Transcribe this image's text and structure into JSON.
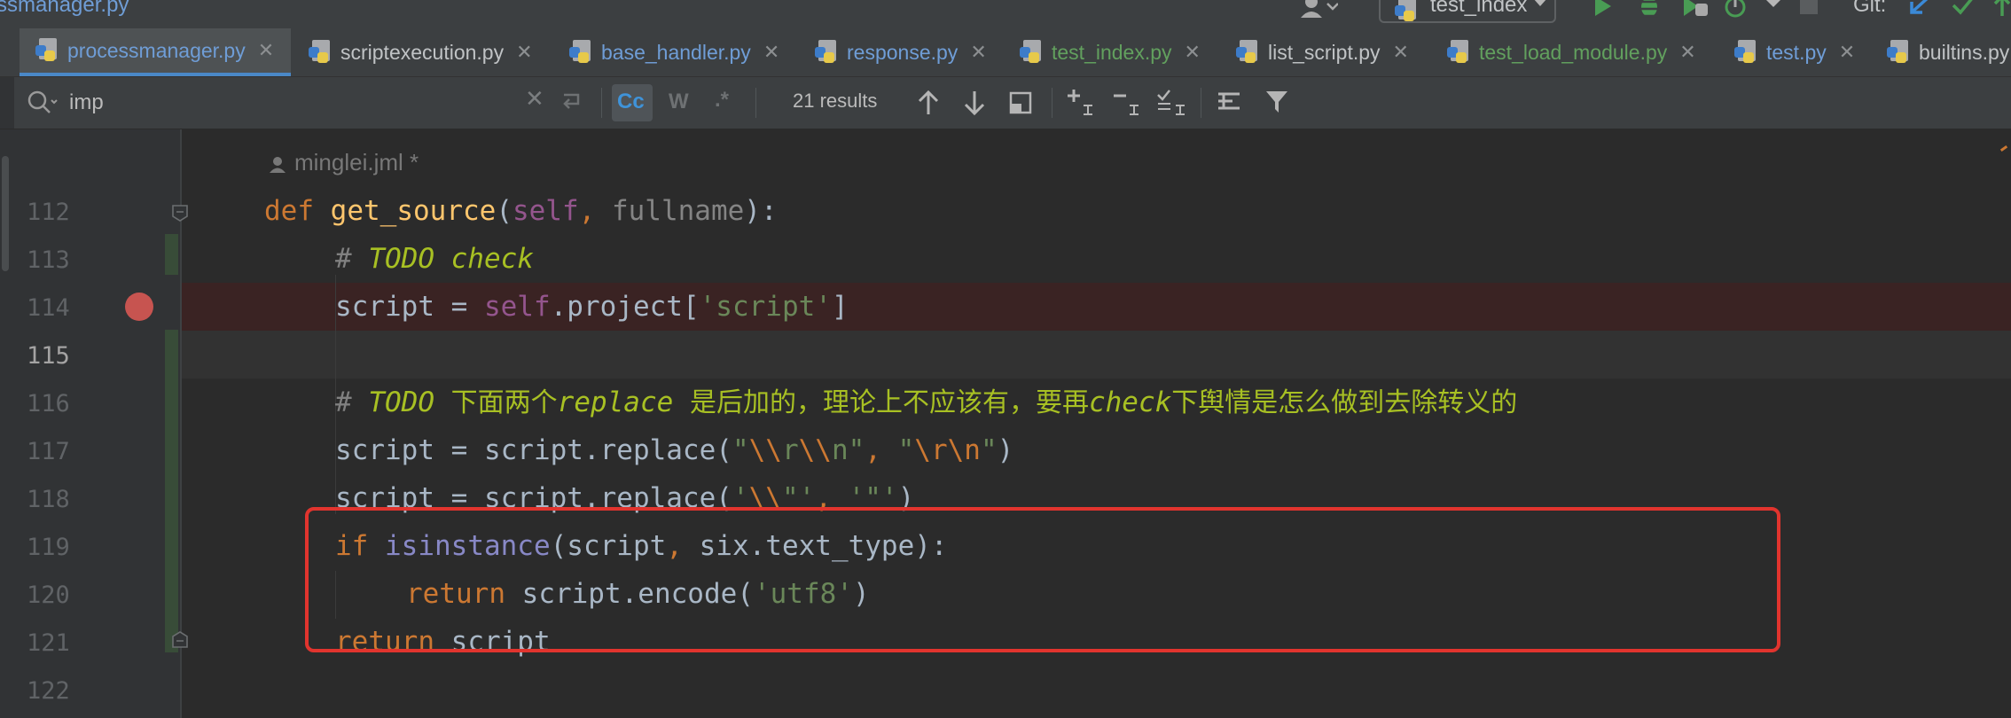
{
  "window": {
    "title": "ssmanager.py",
    "run_config": "test_index",
    "git_label": "Git:"
  },
  "tabs": [
    {
      "label": "processmanager.py",
      "active": true,
      "color": "#6f9dd6"
    },
    {
      "label": "scriptexecution.py",
      "active": false,
      "color": "#c0c3c5"
    },
    {
      "label": "base_handler.py",
      "active": false,
      "color": "#6f9dd6"
    },
    {
      "label": "response.py",
      "active": false,
      "color": "#6f9dd6"
    },
    {
      "label": "test_index.py",
      "active": false,
      "color": "#62a05e"
    },
    {
      "label": "list_script.py",
      "active": false,
      "color": "#c0c3c5"
    },
    {
      "label": "test_load_module.py",
      "active": false,
      "color": "#62a05e"
    },
    {
      "label": "test.py",
      "active": false,
      "color": "#6f9dd6"
    },
    {
      "label": "builtins.py",
      "active": false,
      "color": "#c0c3c5"
    }
  ],
  "search": {
    "query": "imp",
    "match_case_label": "Cc",
    "words_label": "W",
    "regex_label": ".*",
    "results": "21 results"
  },
  "editor": {
    "author_annotation": "minglei.jml *",
    "line_numbers": [
      "112",
      "113",
      "114",
      "115",
      "116",
      "117",
      "118",
      "119",
      "120",
      "121",
      "122"
    ],
    "current_line": "115",
    "breakpoint_line": "114",
    "code": {
      "l112_def": "def",
      "l112_name": "get_source",
      "l112_open": "(",
      "l112_self": "self",
      "l112_comma": ",",
      "l112_param": " fullname",
      "l112_close": "):",
      "l113_hash": "# ",
      "l113_todo": "TODO check",
      "l114_a": "script = ",
      "l114_self": "self",
      "l114_b": ".project[",
      "l114_str": "'script'",
      "l114_c": "]",
      "l116_hash": "# ",
      "l116_t1": "TODO ",
      "l116_c1": "下面两个",
      "l116_t2": "replace ",
      "l116_c2": "是后加的，理论上不应该有，要再",
      "l116_t3": "check",
      "l116_c3": "下舆情是怎么做到去除转义的",
      "l117_a": "script = script.replace(",
      "l117_q1": "\"",
      "l117_e1": "\\\\",
      "l117_s1": "r",
      "l117_e2": "\\\\",
      "l117_s2": "n",
      "l117_q2": "\"",
      "l117_comma": ", ",
      "l117_q3": "\"",
      "l117_e3": "\\r\\n",
      "l117_q4": "\"",
      "l117_b": ")",
      "l118_a": "script = script.replace(",
      "l118_s1": "'",
      "l118_e1": "\\\\",
      "l118_s2": "\"'",
      "l118_comma": ", ",
      "l118_s3": "'\"'",
      "l118_b": ")",
      "l119_if": "if ",
      "l119_bi": "isinstance",
      "l119_a": "(script",
      "l119_comma": ",",
      "l119_b": " six.text_type):",
      "l120_ret": "return ",
      "l120_a": "script.encode(",
      "l120_str": "'utf8'",
      "l120_b": ")",
      "l121_ret": "return ",
      "l121_a": "script"
    }
  },
  "colors": {
    "keyword": "#cc7832",
    "function": "#ffc66d",
    "self": "#94558d",
    "string": "#6a8759",
    "todo": "#a8c023",
    "highlight_box": "#e1342e",
    "breakpoint": "#c75450"
  },
  "icons": [
    "python-file-icon",
    "search-icon",
    "clear-icon",
    "replace-toggle-icon",
    "match-case-icon",
    "words-icon",
    "regex-icon",
    "prev-occurrence-icon",
    "next-occurrence-icon",
    "open-in-window-icon",
    "add-selection-icon",
    "remove-selection-icon",
    "select-all-icon",
    "filter-search-results-icon",
    "filter-icon",
    "run-icon",
    "debug-icon",
    "coverage-icon",
    "profile-icon",
    "stop-icon",
    "git-update-icon",
    "git-commit-icon",
    "breakpoint-icon",
    "fold-icon",
    "user-icon"
  ]
}
